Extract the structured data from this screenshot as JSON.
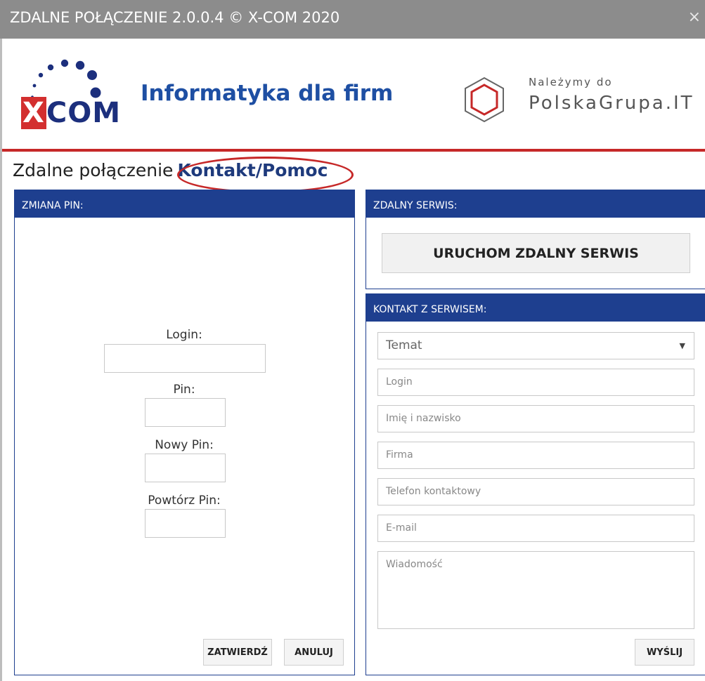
{
  "window": {
    "title": "ZDALNE POŁĄCZENIE 2.0.0.4  © X-COM 2020",
    "close_glyph": "×"
  },
  "header": {
    "logo_text_x": "X",
    "logo_text_rest": "COM",
    "tagline": "Informatyka dla firm",
    "partner_small": "Należymy do",
    "partner_name": "PolskaGrupa.IT"
  },
  "nav": {
    "current": "Zdalne połączenie",
    "link": "Kontakt/Pomoc"
  },
  "pin_panel": {
    "title": "ZMIANA PIN:",
    "login_label": "Login:",
    "pin_label": "Pin:",
    "new_pin_label": "Nowy Pin:",
    "repeat_pin_label": "Powtórz Pin:",
    "confirm_button": "ZATWIERDŹ",
    "cancel_button": "ANULUJ"
  },
  "remote_panel": {
    "title": "ZDALNY SERWIS:",
    "start_button": "URUCHOM ZDALNY SERWIS"
  },
  "contact_panel": {
    "title": "KONTAKT Z SERWISEM:",
    "topic_selected": "Temat",
    "login_placeholder": "Login",
    "name_placeholder": "Imię i nazwisko",
    "company_placeholder": "Firma",
    "phone_placeholder": "Telefon kontaktowy",
    "email_placeholder": "E-mail",
    "message_placeholder": "Wiadomość",
    "send_button": "WYŚLIJ"
  },
  "colors": {
    "accent_blue": "#1e3f8f",
    "brand_red": "#c62828",
    "titlebar": "#8c8c8c"
  }
}
